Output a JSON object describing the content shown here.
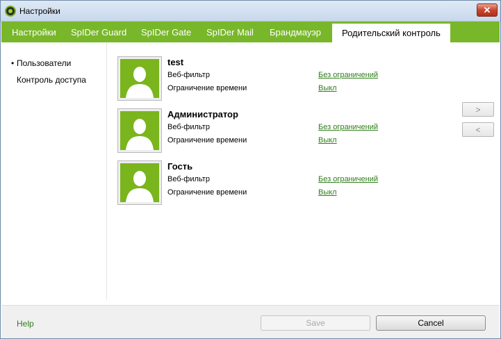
{
  "window": {
    "title": "Настройки",
    "close_label": "✕"
  },
  "tabs": [
    {
      "label": "Настройки"
    },
    {
      "label": "SpIDer Guard"
    },
    {
      "label": "SpIDer Gate"
    },
    {
      "label": "SpIDer Mail"
    },
    {
      "label": "Брандмауэр"
    },
    {
      "label": "Родительский контроль",
      "active": true
    }
  ],
  "sidebar": {
    "items": [
      {
        "label": "Пользователи",
        "selected": true,
        "bullet": "•"
      },
      {
        "label": "Контроль доступа",
        "selected": false,
        "bullet": ""
      }
    ]
  },
  "users": [
    {
      "name": "test",
      "web_filter_label": "Веб-фильтр",
      "web_filter_value": "Без ограничений",
      "time_label": "Ограничение времени",
      "time_value": "Выкл"
    },
    {
      "name": "Администратор",
      "web_filter_label": "Веб-фильтр",
      "web_filter_value": "Без ограничений",
      "time_label": "Ограничение времени",
      "time_value": "Выкл"
    },
    {
      "name": "Гость",
      "web_filter_label": "Веб-фильтр",
      "web_filter_value": "Без ограничений",
      "time_label": "Ограничение времени",
      "time_value": "Выкл"
    }
  ],
  "nav": {
    "next_label": ">",
    "prev_label": "<"
  },
  "footer": {
    "help_label": "Help",
    "save_label": "Save",
    "cancel_label": "Cancel"
  },
  "colors": {
    "accent": "#78b72a",
    "link": "#2e7d1a",
    "avatar_bg": "#7ab51d"
  }
}
